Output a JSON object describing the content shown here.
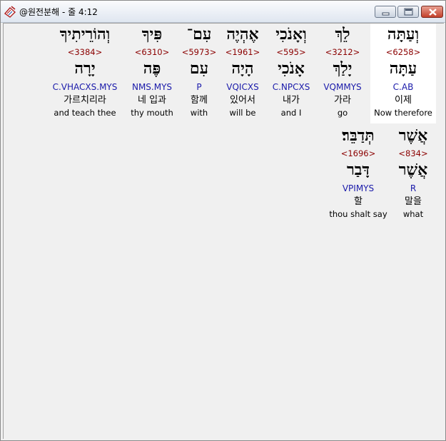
{
  "window": {
    "title": "@원전분해 - 줄 4:12",
    "app_icon": "book-pen-icon"
  },
  "controls": {
    "minimize_icon": "minimize-icon",
    "maximize_icon": "maximize-icon",
    "close_icon": "close-icon"
  },
  "words": [
    {
      "hebrew": "וְעַתָּה",
      "strong": "<6258>",
      "lemma": "עַתָּה",
      "morph": "C.AB",
      "korean": "이제",
      "english": "Now therefore",
      "selected": true
    },
    {
      "hebrew": "לֵךְ",
      "strong": "<3212>",
      "lemma": "יָלַךְ",
      "morph": "VQMMYS",
      "korean": "가라",
      "english": "go",
      "selected": false
    },
    {
      "hebrew": "וְאָנֹכִי",
      "strong": "<595>",
      "lemma": "אָנֹכִי",
      "morph": "C.NPCXS",
      "korean": "내가",
      "english": "and I",
      "selected": false
    },
    {
      "hebrew": "אֶהְיֶה",
      "strong": "<1961>",
      "lemma": "הָיָה",
      "morph": "VQICXS",
      "korean": "있어서",
      "english": "will be",
      "selected": false
    },
    {
      "hebrew": "עִם־",
      "strong": "<5973>",
      "lemma": "עִם",
      "morph": "P",
      "korean": "함께",
      "english": "with",
      "selected": false
    },
    {
      "hebrew": "פִּיךָ",
      "strong": "<6310>",
      "lemma": "פֶּה",
      "morph": "NMS.MYS",
      "korean": "네 입과",
      "english": "thy mouth",
      "selected": false
    },
    {
      "hebrew": "וְהוֹרֵיתִיךָ",
      "strong": "<3384>",
      "lemma": "יָרָה",
      "morph": "C.VHACXS.MYS",
      "korean": "가르치리라",
      "english": "and teach thee",
      "selected": false
    },
    {
      "hebrew": "אֲשֶׁר",
      "strong": "<834>",
      "lemma": "אֲשֶׁר",
      "morph": "R",
      "korean": "말을",
      "english": "what",
      "selected": false
    },
    {
      "hebrew": "תְּדַבֵּר׃",
      "strong": "<1696>",
      "lemma": "דָּבַר",
      "morph": "VPIMYS",
      "korean": "할",
      "english": "thou shalt say",
      "selected": false
    }
  ]
}
